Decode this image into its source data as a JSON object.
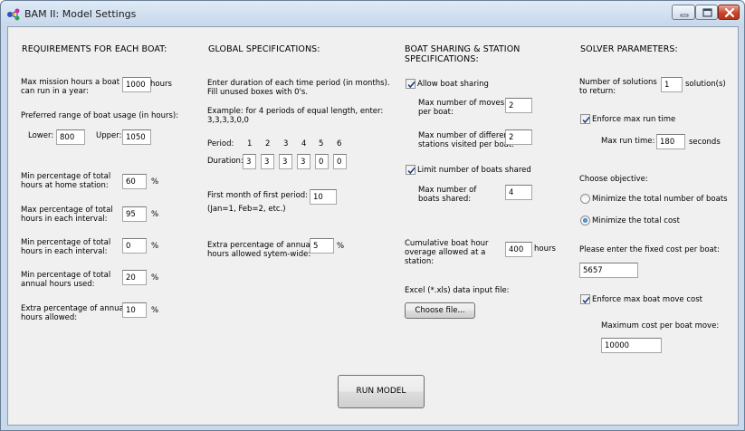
{
  "window": {
    "title": "BAM II:  Model Settings",
    "icon": "molecule-app-icon",
    "controls": {
      "minimize": "minimize-icon",
      "maximize": "maximize-icon",
      "close": "close-icon"
    }
  },
  "boat_reqs": {
    "header": "REQUIREMENTS FOR EACH BOAT:",
    "max_mission_label_1": "Max mission hours a boat",
    "max_mission_label_2": "can run in a year:",
    "max_mission_value": "1000",
    "max_mission_unit": "hours",
    "range_label": "Preferred range of boat usage (in hours):",
    "lower_label": "Lower:",
    "lower_value": "800",
    "upper_label": "Upper:",
    "upper_value": "1050",
    "home_label_1": "Min percentage of total",
    "home_label_2": "hours at home station:",
    "home_value": "60",
    "home_unit": "%",
    "max_interval_label_1": "Max percentage of total",
    "max_interval_label_2": "hours in each interval:",
    "max_interval_value": "95",
    "max_interval_unit": "%",
    "min_interval_label_1": "Min percentage of total",
    "min_interval_label_2": "hours in each interval:",
    "min_interval_value": "0",
    "min_interval_unit": "%",
    "annual_label_1": "Min percentage of total",
    "annual_label_2": "annual hours used:",
    "annual_value": "20",
    "annual_unit": "%",
    "extra_label_1": "Extra percentage of annual",
    "extra_label_2": "hours allowed:",
    "extra_value": "10",
    "extra_unit": "%"
  },
  "global": {
    "header": "GLOBAL SPECIFICATIONS:",
    "duration_desc_1": "Enter duration of each time period (in months).",
    "duration_desc_2": "Fill unused boxes with 0's.",
    "example_1": "Example: for 4 periods of equal length, enter:",
    "example_2": "3,3,3,3,0,0",
    "period_label": "Period:",
    "periods": [
      "1",
      "2",
      "3",
      "4",
      "5",
      "6"
    ],
    "duration_label": "Duration:",
    "durations": [
      "3",
      "3",
      "3",
      "3",
      "0",
      "0"
    ],
    "first_month_label": "First month of first period:",
    "first_month_value": "10",
    "month_hint": "(Jan=1, Feb=2, etc.)",
    "extra_label_1": "Extra percentage of annual",
    "extra_label_2": "hours allowed sytem-wide:",
    "extra_value": "5",
    "extra_unit": "%"
  },
  "sharing": {
    "header_1": "BOAT SHARING & STATION",
    "header_2": "SPECIFICATIONS:",
    "allow_label": "Allow boat sharing",
    "allow_checked": true,
    "max_moves_label_1": "Max number of moves",
    "max_moves_label_2": "per boat:",
    "max_moves_value": "2",
    "max_stations_label_1": "Max number of different",
    "max_stations_label_2": "stations visited per boat:",
    "max_stations_value": "2",
    "limit_label": "Limit number of boats shared",
    "limit_checked": true,
    "max_shared_label_1": "Max number of",
    "max_shared_label_2": "boats shared:",
    "max_shared_value": "4",
    "cumulative_label_1": "Cumulative boat hour",
    "cumulative_label_2": "overage allowed at a",
    "cumulative_label_3": "station:",
    "cumulative_value": "400",
    "cumulative_unit": "hours",
    "excel_label": "Excel (*.xls) data input file:",
    "choose_file": "Choose file..."
  },
  "solver": {
    "header": "SOLVER PARAMETERS:",
    "num_solutions_label_1": "Number of solutions",
    "num_solutions_label_2": "to return:",
    "num_solutions_value": "1",
    "num_solutions_unit": "solution(s)",
    "enforce_runtime_label": "Enforce max run time",
    "enforce_runtime_checked": true,
    "max_runtime_label": "Max run time:",
    "max_runtime_value": "180",
    "max_runtime_unit": "seconds",
    "objective_label": "Choose objective:",
    "objective_options": [
      "Minimize the total number of boats",
      "Minimize the total cost"
    ],
    "objective_selected": "Minimize the total cost",
    "fixed_cost_label": "Please enter the fixed cost per boat:",
    "fixed_cost_value": "5657",
    "enforce_move_cost_label": "Enforce max boat move cost",
    "enforce_move_cost_checked": true,
    "max_move_cost_label": "Maximum cost per boat move:",
    "max_move_cost_value": "10000"
  },
  "run_button": "RUN MODEL"
}
